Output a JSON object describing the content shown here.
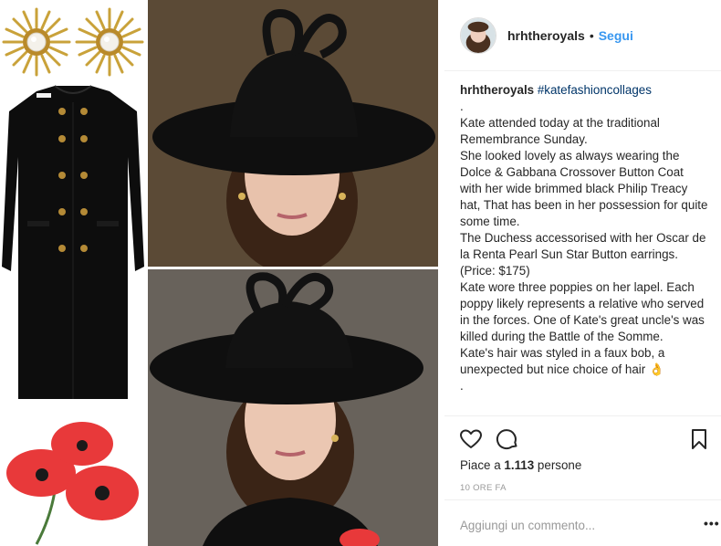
{
  "post": {
    "username": "hrhtheroyals",
    "follow_label": "Segui",
    "separator": "•"
  },
  "caption": {
    "username": "hrhtheroyals",
    "hashtag": "#katefashioncollages",
    "lines": [
      ".",
      "Kate attended today at the traditional Remembrance Sunday.",
      "She looked lovely as always wearing the Dolce & Gabbana Crossover Button Coat with her wide brimmed black Philip Treacy hat, That has been in her possession for quite some time.",
      "The Duchess accessorised with her Oscar de la Renta Pearl Sun Star Button earrings. (Price: $175)",
      "Kate wore three poppies on her lapel. Each poppy likely represents a relative who served in the forces. One of Kate's great uncle's was killed during the Battle of the Somme.",
      "Kate's hair was styled in a faux bob, a unexpected but nice choice of hair 👌",
      "."
    ]
  },
  "engagement": {
    "likes_prefix": "Piace a",
    "likes_count": "1.113",
    "likes_suffix": "persone",
    "timestamp": "10 ORE FA"
  },
  "comment": {
    "placeholder": "Aggiungi un commento...",
    "more_label": "•••"
  },
  "icons": {
    "like": "heart-outline-icon",
    "comment": "comment-bubble-icon",
    "save": "bookmark-icon",
    "more": "ellipsis-icon"
  },
  "colors": {
    "link": "#3897f0",
    "hashtag": "#003569",
    "muted": "#999999",
    "divider": "#efefef",
    "poppy": "#e8393a"
  }
}
